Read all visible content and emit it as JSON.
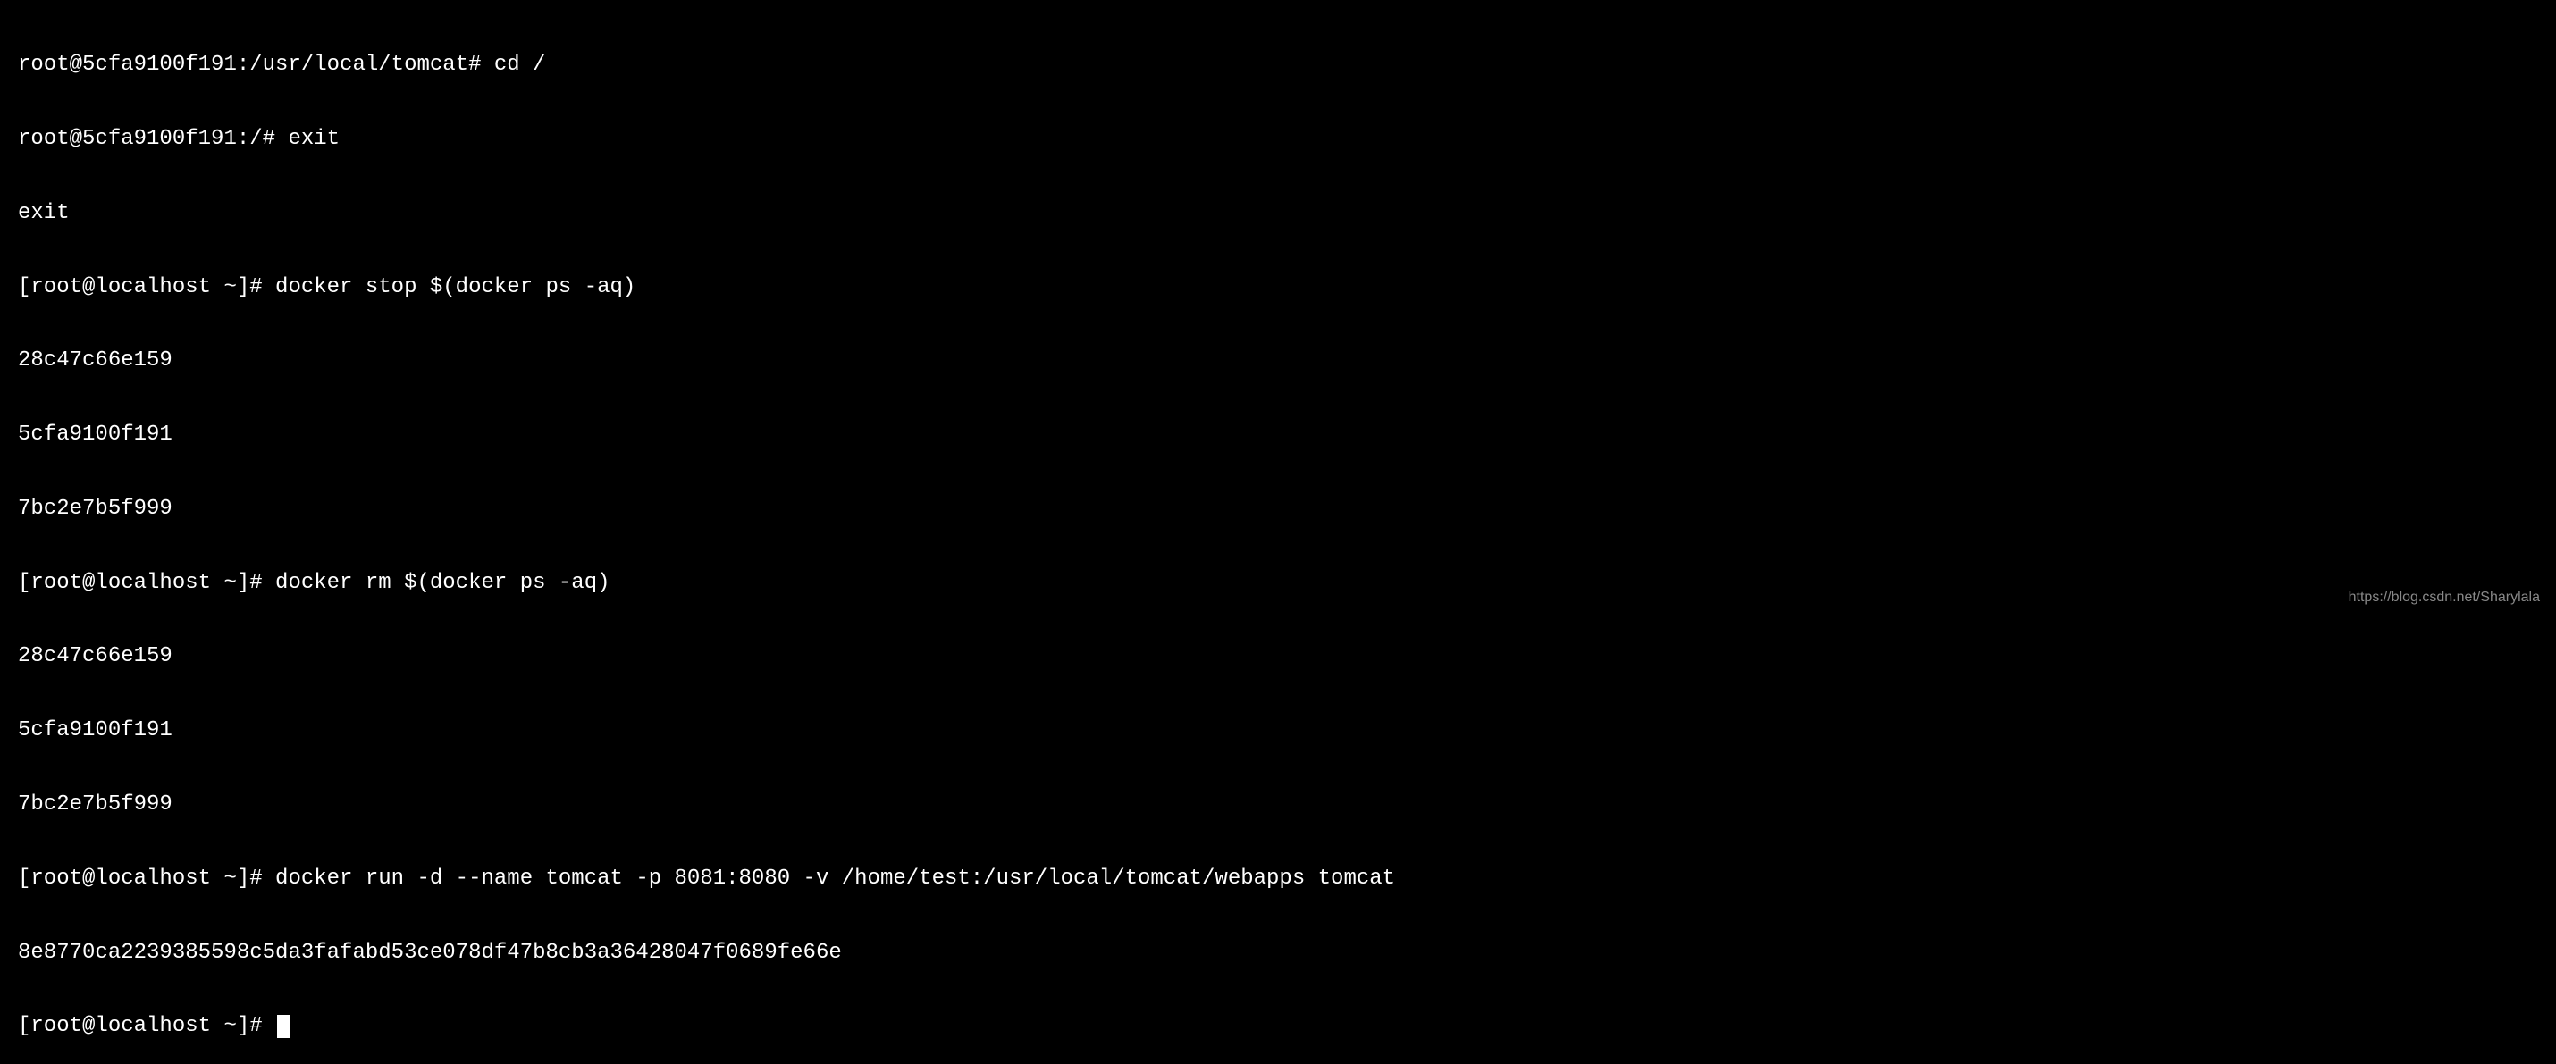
{
  "terminal": {
    "lines": [
      {
        "prompt": "root@5cfa9100f191:/usr/local/tomcat# ",
        "command": "cd /"
      },
      {
        "prompt": "root@5cfa9100f191:/# ",
        "command": "exit"
      },
      {
        "output": "exit"
      },
      {
        "prompt": "[root@localhost ~]# ",
        "command": "docker stop $(docker ps -aq)"
      },
      {
        "output": "28c47c66e159"
      },
      {
        "output": "5cfa9100f191"
      },
      {
        "output": "7bc2e7b5f999"
      },
      {
        "prompt": "[root@localhost ~]# ",
        "command": "docker rm $(docker ps -aq)"
      },
      {
        "output": "28c47c66e159"
      },
      {
        "output": "5cfa9100f191"
      },
      {
        "output": "7bc2e7b5f999"
      },
      {
        "prompt": "[root@localhost ~]# ",
        "command": "docker run -d --name tomcat -p 8081:8080 -v /home/test:/usr/local/tomcat/webapps tomcat"
      },
      {
        "output": "8e8770ca2239385598c5da3fafabd53ce078df47b8cb3a36428047f0689fe66e"
      },
      {
        "prompt": "[root@localhost ~]# ",
        "command": "",
        "cursor": true
      }
    ]
  },
  "watermark": "https://blog.csdn.net/Sharylala"
}
